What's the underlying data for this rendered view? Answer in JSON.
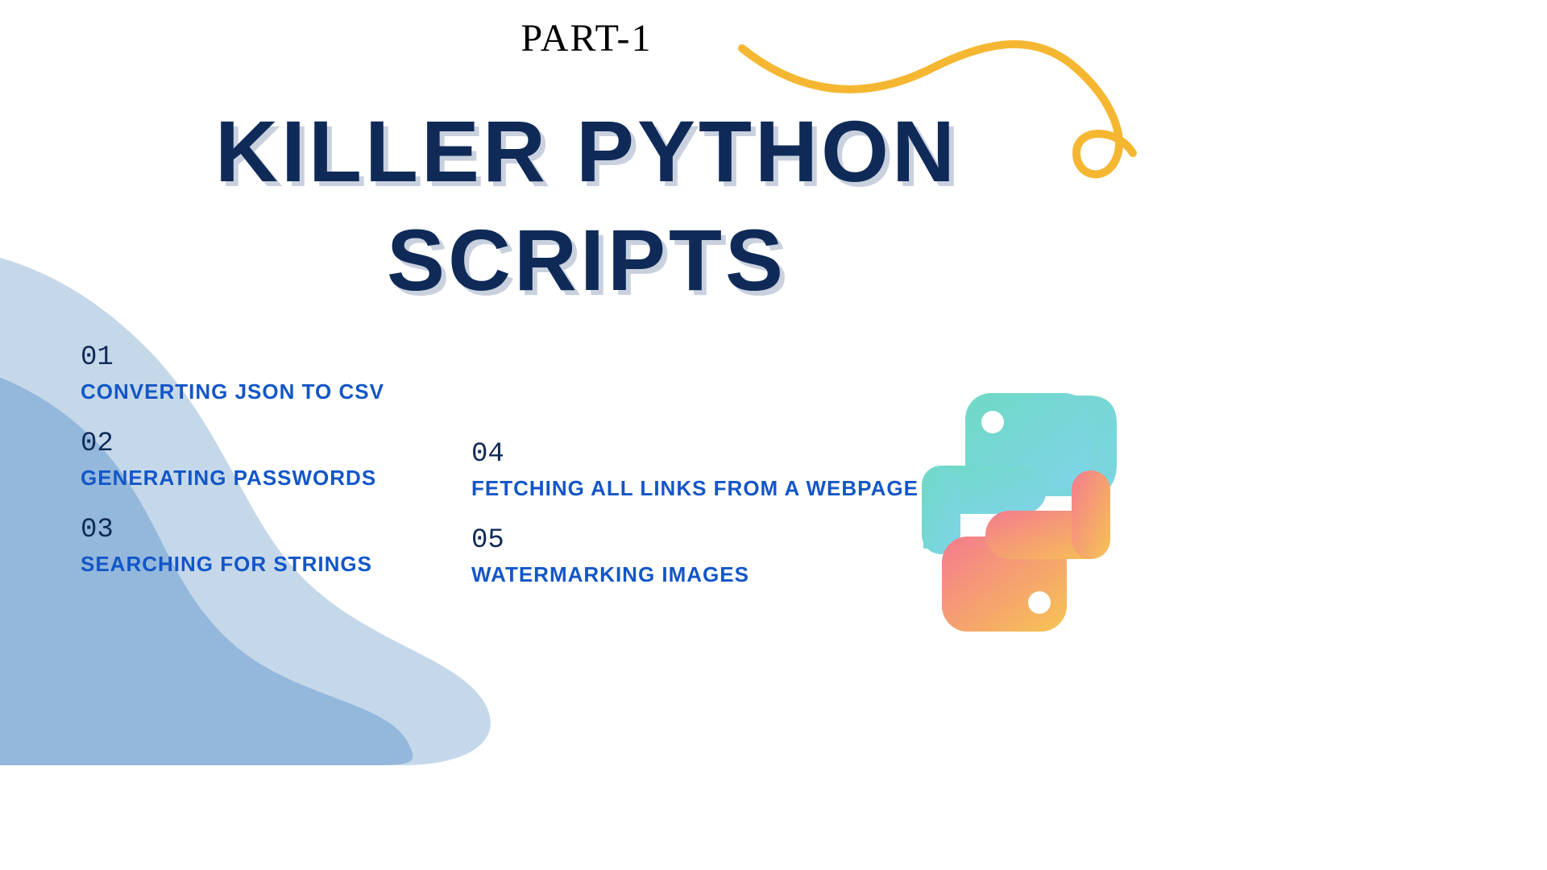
{
  "header": {
    "subtitle": "PART-1",
    "title_line1": "KILLER PYTHON",
    "title_line2": "SCRIPTS"
  },
  "items_left": [
    {
      "num": "01",
      "label": "CONVERTING JSON TO CSV"
    },
    {
      "num": "02",
      "label": "GENERATING PASSWORDS"
    },
    {
      "num": "03",
      "label": "SEARCHING FOR STRINGS"
    }
  ],
  "items_right": [
    {
      "num": "04",
      "label": "FETCHING ALL LINKS FROM A WEBPAGE"
    },
    {
      "num": "05",
      "label": "WATERMARKING IMAGES"
    }
  ],
  "colors": {
    "dark_navy": "#0f2a57",
    "blue": "#1356c7",
    "blob_light": "#c5d8ea",
    "blob_mid": "#94b8dc",
    "squiggle": "#f5b731"
  }
}
